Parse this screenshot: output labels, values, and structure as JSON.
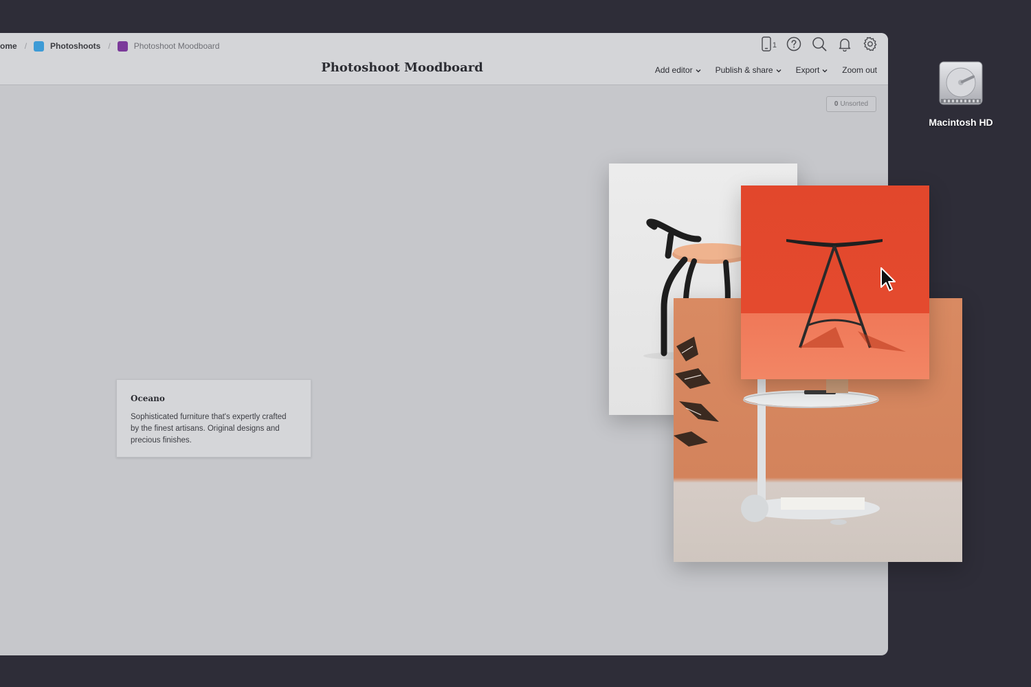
{
  "desktop": {
    "drive_label": "Macintosh HD"
  },
  "breadcrumb": {
    "items": [
      {
        "label": "ome",
        "color": ""
      },
      {
        "label": "Photoshoots",
        "color": "#3d9bd6"
      },
      {
        "label": "Photoshoot Moodboard",
        "color": "#7b3a9a"
      }
    ]
  },
  "toolbar": {
    "device_count": "1",
    "icons": [
      "phone-icon",
      "help-icon",
      "search-icon",
      "bell-icon",
      "gear-icon"
    ]
  },
  "page": {
    "title": "Photoshoot Moodboard"
  },
  "menu": {
    "add_editor": "Add editor",
    "publish_share": "Publish & share",
    "export": "Export",
    "zoom_out": "Zoom out"
  },
  "board": {
    "unsorted_count": "0",
    "unsorted_label": "Unsorted",
    "note": {
      "title": "Oceano",
      "body": "Sophisticated furniture that's expertly crafted by the finest artisans. Original designs and precious finishes."
    }
  },
  "colors": {
    "desktop_bg": "#2e2d38",
    "window_bg": "#c6c7cb",
    "toolbar_bg": "#d4d5d8",
    "stool_photo_red": "#e2472c",
    "cart_photo_orange": "#d98a62"
  }
}
